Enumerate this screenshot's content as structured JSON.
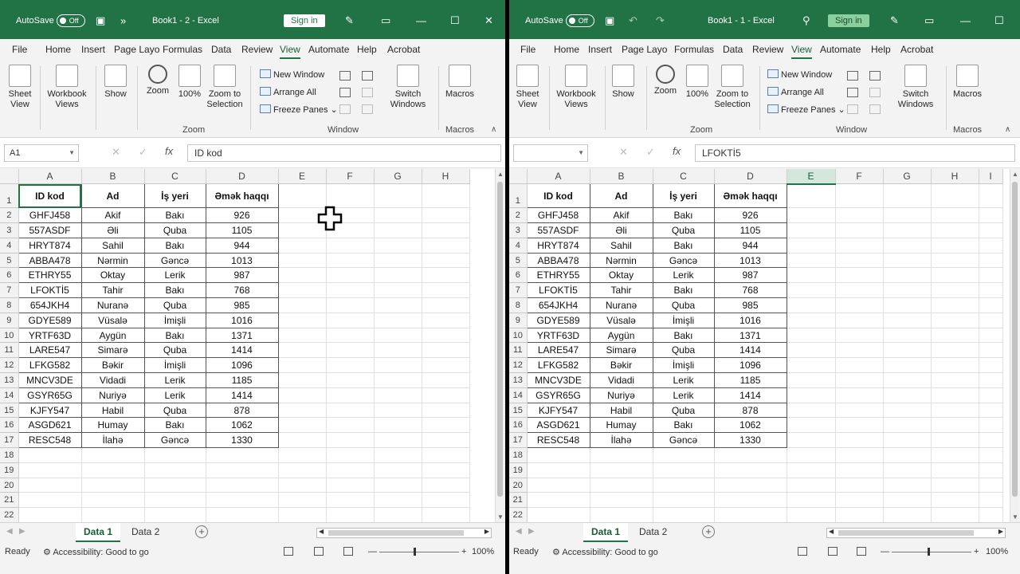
{
  "left": {
    "autosave_label": "AutoSave",
    "autosave_state": "Off",
    "title": "Book1  -  2  -  Excel",
    "sign_in": "Sign in",
    "name_box": "A1",
    "formula": "ID kod",
    "selected_cell": "A1",
    "columns": [
      "A",
      "B",
      "C",
      "D",
      "E",
      "F",
      "G",
      "H"
    ],
    "rows_shown": 22
  },
  "right": {
    "autosave_label": "AutoSave",
    "autosave_state": "Off",
    "title": "Book1  -  1  -  Excel",
    "sign_in": "Sign in",
    "name_box": "",
    "formula": "LFOKTİ5",
    "selected_column": "E",
    "columns": [
      "A",
      "B",
      "C",
      "D",
      "E",
      "F",
      "G",
      "H",
      "I"
    ],
    "rows_shown": 22
  },
  "menu": [
    "File",
    "Home",
    "Insert",
    "Page Layo",
    "Formulas",
    "Data",
    "Review",
    "View",
    "Automate",
    "Help",
    "Acrobat"
  ],
  "menu_active": "View",
  "ribbon": {
    "sheet_view": "Sheet View",
    "workbook_views": "Workbook Views",
    "show": "Show",
    "zoom": "Zoom",
    "zoom100": "100%",
    "zoom_to_selection": "Zoom to Selection",
    "new_window": "New Window",
    "arrange_all": "Arrange All",
    "freeze_panes": "Freeze Panes",
    "switch_windows": "Switch Windows",
    "macros": "Macros",
    "group_zoom": "Zoom",
    "group_window": "Window",
    "group_macros": "Macros"
  },
  "table": {
    "headers": [
      "ID kod",
      "Ad",
      "İş yeri",
      "Əmək haqqı"
    ],
    "rows": [
      [
        "GHFJ458",
        "Akif",
        "Bakı",
        "926"
      ],
      [
        "557ASDF",
        "Əli",
        "Quba",
        "1105"
      ],
      [
        "HRYT874",
        "Sahil",
        "Bakı",
        "944"
      ],
      [
        "ABBA478",
        "Nərmin",
        "Gəncə",
        "1013"
      ],
      [
        "ETHRY55",
        "Oktay",
        "Lerik",
        "987"
      ],
      [
        "LFOKTİ5",
        "Tahir",
        "Bakı",
        "768"
      ],
      [
        "654JKH4",
        "Nuranə",
        "Quba",
        "985"
      ],
      [
        "GDYE589",
        "Vüsalə",
        "İmişli",
        "1016"
      ],
      [
        "YRTF63D",
        "Aygün",
        "Bakı",
        "1371"
      ],
      [
        "LARE547",
        "Simarə",
        "Quba",
        "1414"
      ],
      [
        "LFKG582",
        "Bəkir",
        "İmişli",
        "1096"
      ],
      [
        "MNCV3DE",
        "Vidadi",
        "Lerik",
        "1185"
      ],
      [
        "GSYR65G",
        "Nuriyə",
        "Lerik",
        "1414"
      ],
      [
        "KJFY547",
        "Habil",
        "Quba",
        "878"
      ],
      [
        "ASGD621",
        "Humay",
        "Bakı",
        "1062"
      ],
      [
        "RESC548",
        "İlahə",
        "Gəncə",
        "1330"
      ]
    ]
  },
  "tabs": [
    "Data 1",
    "Data 2"
  ],
  "active_tab": "Data 1",
  "status": {
    "ready": "Ready",
    "accessibility": "Accessibility: Good to go",
    "zoom": "100%"
  },
  "colors": {
    "excel_green": "#217346",
    "dark_green": "#185c37"
  }
}
